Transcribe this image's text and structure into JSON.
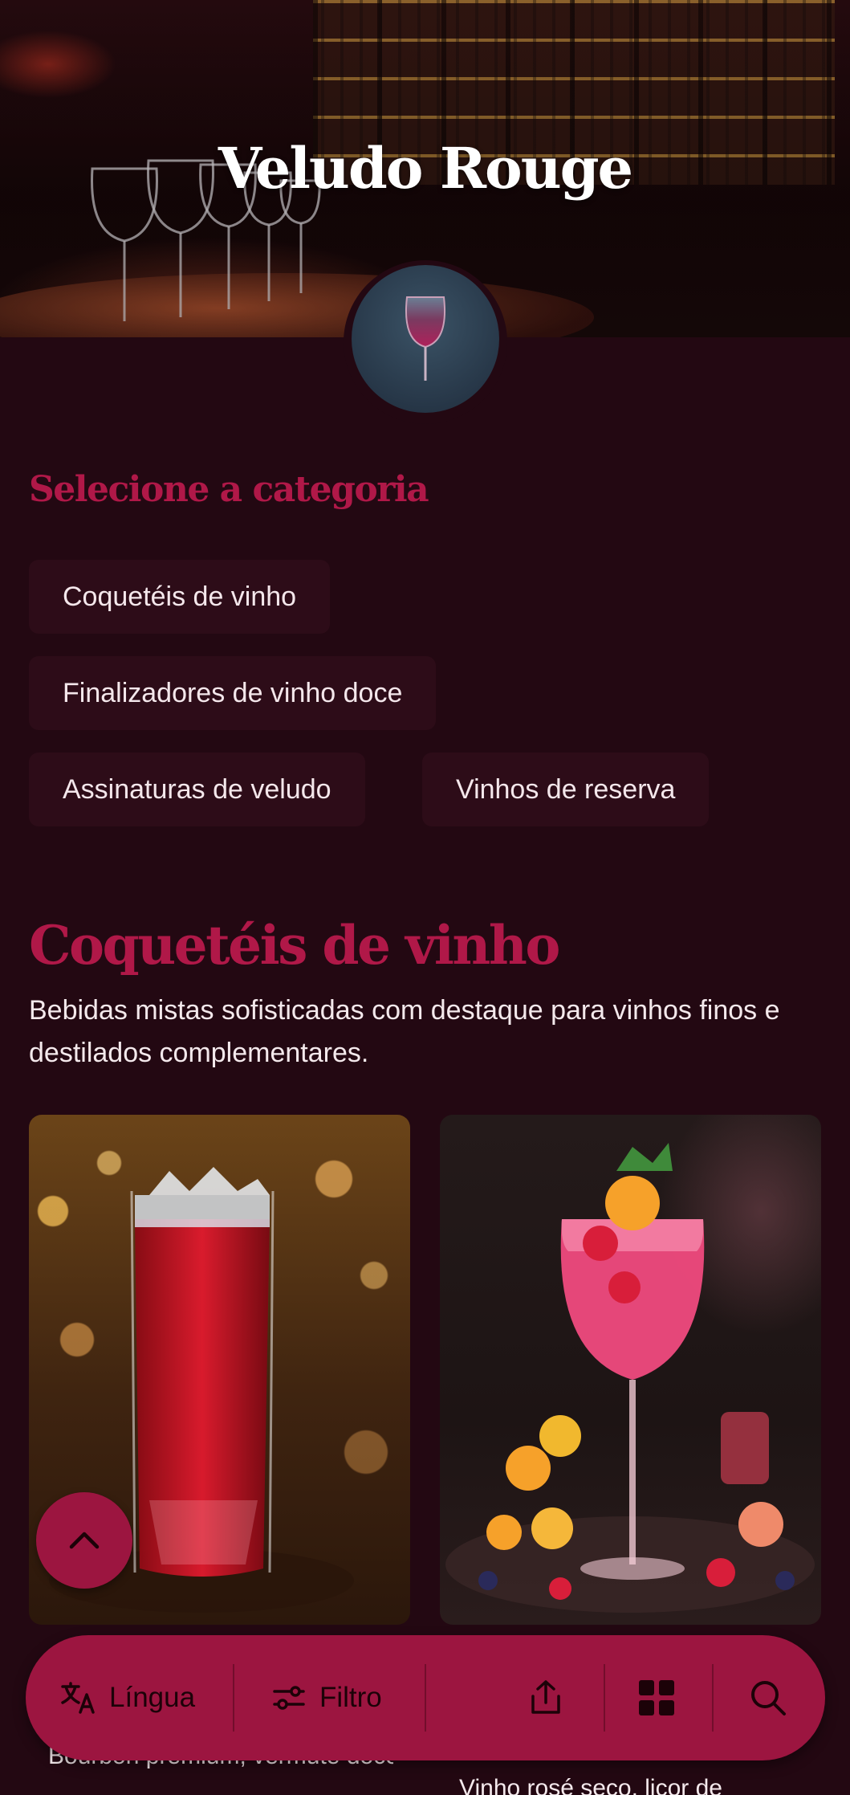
{
  "app": {
    "title": "Veludo Rouge"
  },
  "categories": {
    "heading": "Selecione a categoria",
    "chips": [
      "Coquetéis de vinho",
      "Finalizadores de vinho doce",
      "Assinaturas de veludo",
      "Vinhos de reserva"
    ]
  },
  "current_category": {
    "title": "Coquetéis de vinho",
    "description": "Bebidas mistas sofisticadas com destaque para vinhos finos e destilados complementares.",
    "items": [
      {
        "description": "Bourbon premium, vermute doce e um pouco de cabern"
      },
      {
        "description": "Vinho rosé seco, licor de"
      }
    ]
  },
  "bottom_bar": {
    "language_label": "Língua",
    "filter_label": "Filtro"
  },
  "colors": {
    "background": "#230812",
    "accent": "#b01848",
    "bar": "#9c1540",
    "chip": "#2d0c18"
  },
  "icons": [
    "wine-glass-icon",
    "chevron-up-icon",
    "translate-icon",
    "filter-icon",
    "share-icon",
    "grid-icon",
    "search-icon"
  ]
}
